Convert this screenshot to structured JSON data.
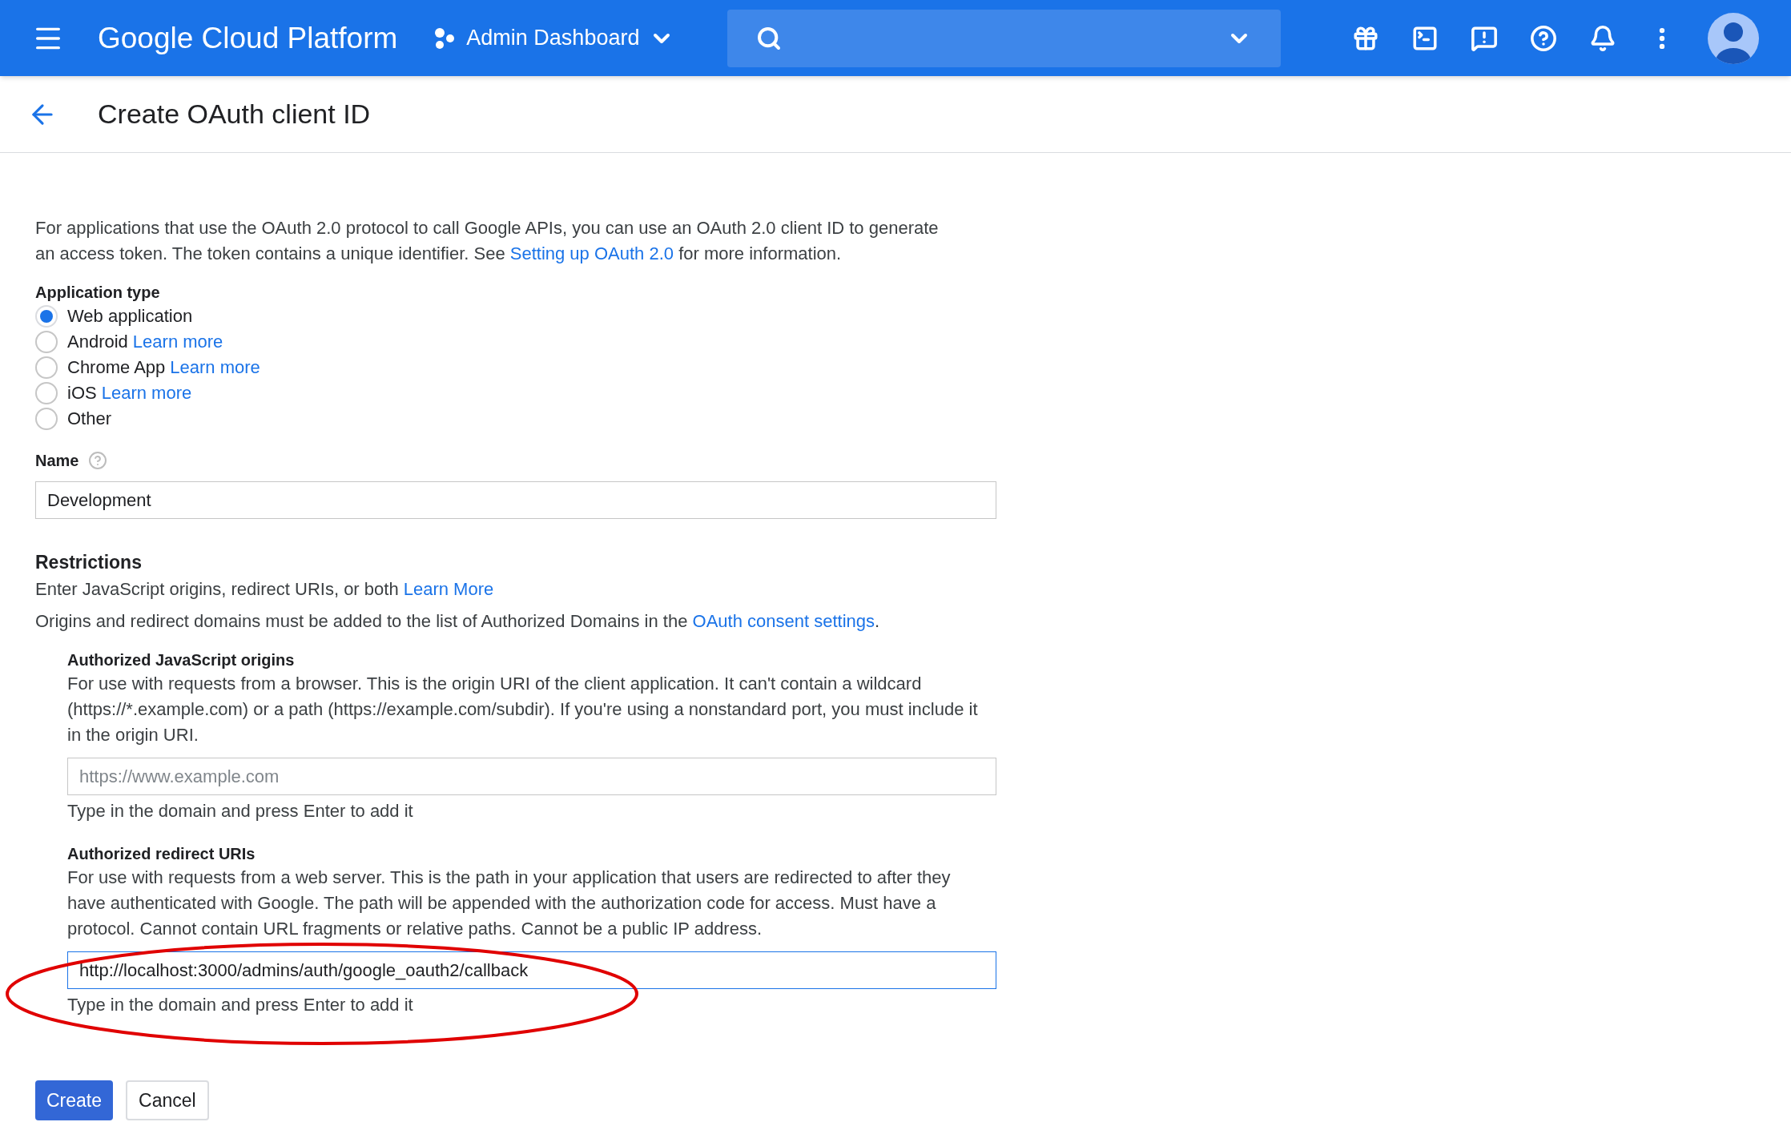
{
  "header": {
    "product": "Google Cloud Platform",
    "project": "Admin Dashboard"
  },
  "page_title": "Create OAuth client ID",
  "intro": {
    "before": "For applications that use the OAuth 2.0 protocol to call Google APIs, you can use an OAuth 2.0 client ID to generate an access token. The token contains a unique identifier. See ",
    "link": "Setting up OAuth 2.0",
    "after": " for more information."
  },
  "application_type": {
    "label": "Application type",
    "options": [
      {
        "label": "Web application",
        "selected": true
      },
      {
        "label": "Android",
        "link": "Learn more",
        "selected": false
      },
      {
        "label": "Chrome App",
        "link": "Learn more",
        "selected": false
      },
      {
        "label": "iOS",
        "link": "Learn more",
        "selected": false
      },
      {
        "label": "Other",
        "selected": false
      }
    ]
  },
  "name": {
    "label": "Name",
    "value": "Development"
  },
  "restrictions": {
    "title": "Restrictions",
    "line1": {
      "before": "Enter JavaScript origins, redirect URIs, or both ",
      "link": "Learn More"
    },
    "line2": {
      "before": "Origins and redirect domains must be added to the list of Authorized Domains in the ",
      "link": "OAuth consent settings",
      "after": "."
    },
    "sections": [
      {
        "title": "Authorized JavaScript origins",
        "description": "For use with requests from a browser. This is the origin URI of the client application. It can't contain a wildcard (https://*.example.com) or a path (https://example.com/subdir). If you're using a nonstandard port, you must include it in the origin URI.",
        "placeholder": "https://www.example.com",
        "focused": false,
        "hint": "Type in the domain and press Enter to add it"
      },
      {
        "title": "Authorized redirect URIs",
        "description": "For use with requests from a web server. This is the path in your application that users are redirected to after they have authenticated with Google. The path will be appended with the authorization code for access. Must have a protocol. Cannot contain URL fragments or relative paths. Cannot be a public IP address.",
        "value": "http://localhost:3000/admins/auth/google_oauth2/callback",
        "focused": true,
        "hint": "Type in the domain and press Enter to add it"
      }
    ]
  },
  "buttons": [
    {
      "label": "Create",
      "kind": "primary"
    },
    {
      "label": "Cancel",
      "kind": "secondary"
    }
  ]
}
